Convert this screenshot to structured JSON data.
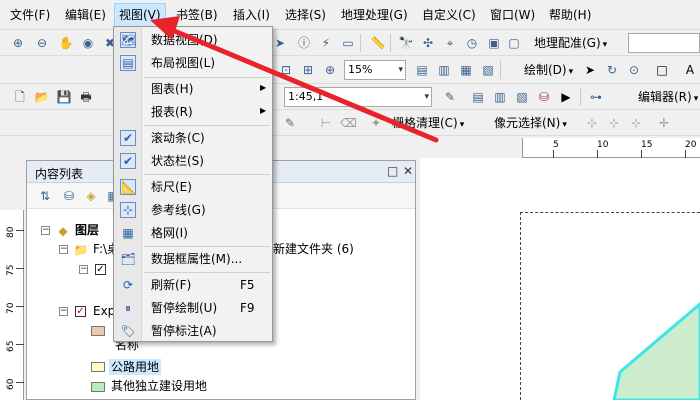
{
  "menubar": {
    "items": [
      {
        "label": "文件(F)",
        "active": false
      },
      {
        "label": "编辑(E)",
        "active": false
      },
      {
        "label": "视图(V)",
        "active": true
      },
      {
        "label": "书签(B)",
        "active": false
      },
      {
        "label": "插入(I)",
        "active": false
      },
      {
        "label": "选择(S)",
        "active": false
      },
      {
        "label": "地理处理(G)",
        "active": false
      },
      {
        "label": "自定义(C)",
        "active": false
      },
      {
        "label": "窗口(W)",
        "active": false
      },
      {
        "label": "帮助(H)",
        "active": false
      }
    ]
  },
  "toolbars": {
    "georef_label": "地理配准(G)",
    "zoom_scale": "15%",
    "draw_label": "绘制(D)",
    "map_scale": "1:45,1",
    "editor_label": "编辑器(R)",
    "raster_cleanup": "栅格清理(C)",
    "pixel_select": "像元选择(N)"
  },
  "view_menu": {
    "items": [
      {
        "label": "数据视图(D)",
        "shortcut": "",
        "submenu": false,
        "icon": "data-view-icon",
        "glyph": "🗺"
      },
      {
        "label": "布局视图(L)",
        "shortcut": "",
        "submenu": false,
        "icon": "layout-view-icon",
        "glyph": "▤"
      },
      {
        "label": "图表(H)",
        "shortcut": "",
        "submenu": true,
        "icon": "",
        "glyph": ""
      },
      {
        "label": "报表(R)",
        "shortcut": "",
        "submenu": true,
        "icon": "",
        "glyph": ""
      },
      {
        "label": "滚动条(C)",
        "shortcut": "",
        "submenu": false,
        "icon": "checkmark-icon",
        "glyph": "✔"
      },
      {
        "label": "状态栏(S)",
        "shortcut": "",
        "submenu": false,
        "icon": "checkmark-icon",
        "glyph": "✔"
      },
      {
        "label": "标尺(E)",
        "shortcut": "",
        "submenu": false,
        "icon": "rulers-icon",
        "glyph": "📐"
      },
      {
        "label": "参考线(G)",
        "shortcut": "",
        "submenu": false,
        "icon": "guides-icon",
        "glyph": "⊹"
      },
      {
        "label": "格网(I)",
        "shortcut": "",
        "submenu": false,
        "icon": "grid-icon",
        "glyph": "▦"
      },
      {
        "label": "数据框属性(M)...",
        "shortcut": "",
        "submenu": false,
        "icon": "data-frame-properties-icon",
        "glyph": "🗂"
      },
      {
        "label": "刷新(F)",
        "shortcut": "F5",
        "submenu": false,
        "icon": "refresh-icon",
        "glyph": "⟳"
      },
      {
        "label": "暂停绘制(U)",
        "shortcut": "F9",
        "submenu": false,
        "icon": "pause-drawing-icon",
        "glyph": "⏸"
      },
      {
        "label": "暂停标注(A)",
        "shortcut": "",
        "submenu": false,
        "icon": "pause-labeling-icon",
        "glyph": "🏷"
      }
    ]
  },
  "toc": {
    "title": "内容列表",
    "layers_label": "图层",
    "folder_label": "F:\\桌",
    "folder_suffix": "新建文件夹 (6)",
    "exp_label": "Exp",
    "name_label": "名称",
    "legend_items": [
      {
        "label": "公路用地",
        "color": "#fffbc8",
        "selected": true
      },
      {
        "label": "其他独立建设用地",
        "color": "#b8ecb8",
        "selected": false
      }
    ]
  },
  "ruler": {
    "marks": [
      "5",
      "10",
      "15",
      "20"
    ]
  },
  "vruler": {
    "marks": [
      "80",
      "75",
      "70",
      "65",
      "60"
    ]
  },
  "colors": {
    "accent": "#cce8ff",
    "arrow": "#e8232a",
    "polygon_fill": "#cdeccd",
    "polygon_stroke": "#3ee6e6"
  }
}
